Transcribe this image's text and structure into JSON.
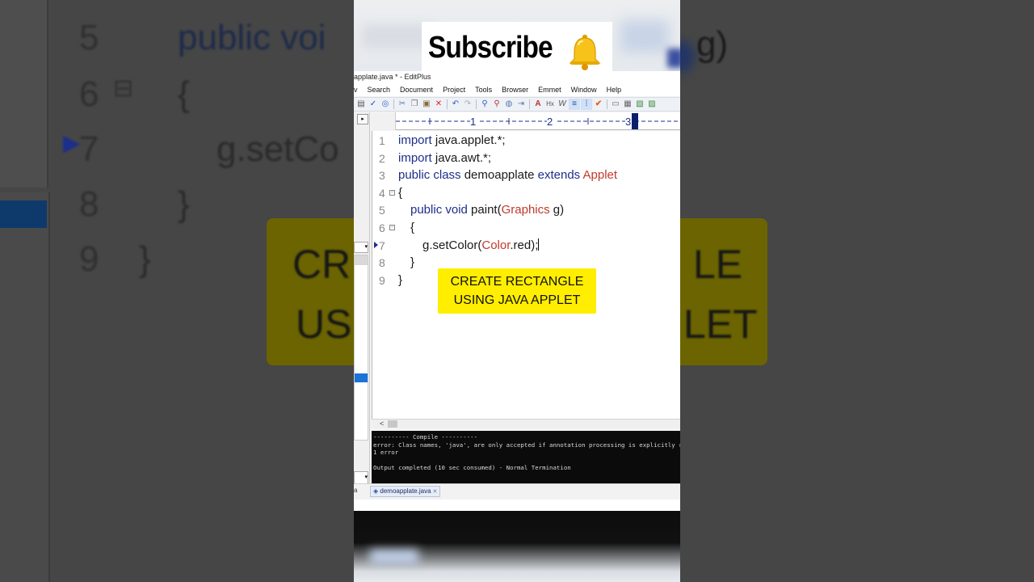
{
  "overlay": {
    "subscribe_label": "Subscribe",
    "bell_icon": "bell-icon",
    "caption_line1": "CREATE RECTANGLE",
    "caption_line2": "USING JAVA APPLET"
  },
  "window": {
    "title": "applate.java * - EditPlus"
  },
  "menu": [
    "Search",
    "Document",
    "Project",
    "Tools",
    "Browser",
    "Emmet",
    "Window",
    "Help"
  ],
  "menu_prefix": "v",
  "ruler": {
    "marks": [
      "1",
      "2",
      "3"
    ]
  },
  "editor": {
    "line_numbers": [
      "1",
      "2",
      "3",
      "4",
      "5",
      "6",
      "7",
      "8",
      "9"
    ],
    "lines": [
      {
        "kw": "import",
        "rest": " java.applet.*;"
      },
      {
        "kw": "import",
        "rest": " java.awt.*;"
      },
      {
        "kw": "public class",
        "mid": " demoapplate ",
        "kw2": "extends",
        "cls": " Applet"
      },
      {
        "rest": "{"
      },
      {
        "kw": "public void",
        "mid": " paint(",
        "cls": "Graphics",
        "rest": " g)"
      },
      {
        "rest": "{"
      },
      {
        "pre": "g.setColor(",
        "cls": "Color",
        "rest": ".red);"
      },
      {
        "rest": "}"
      },
      {
        "rest": "}"
      }
    ]
  },
  "output": {
    "lines": [
      "---------- Compile ----------",
      "error: Class names, 'java', are only accepted if annotation processing is explicitly requested",
      "1 error",
      "",
      "Output completed (10 sec consumed) - Normal Termination"
    ]
  },
  "tabs": {
    "left_fragment": "a",
    "active": "demoapplate.java"
  },
  "background": {
    "line5": "public voi",
    "line5_num": "5",
    "line6_num": "6",
    "line6": "{",
    "line7_num": "7",
    "line7": "g.setCo",
    "line8_num": "8",
    "line8": "}",
    "line9_num": "9",
    "line9": "}",
    "right_frag": "g)",
    "caption_l1a": "CR",
    "caption_l1b": "LE",
    "caption_l2a": "US",
    "caption_l2b": "LET"
  },
  "colors": {
    "caption_bg": "#ffee00",
    "keyword": "#1c2f8a",
    "class_name": "#c0392b",
    "output_bg": "#0b0b0b"
  }
}
